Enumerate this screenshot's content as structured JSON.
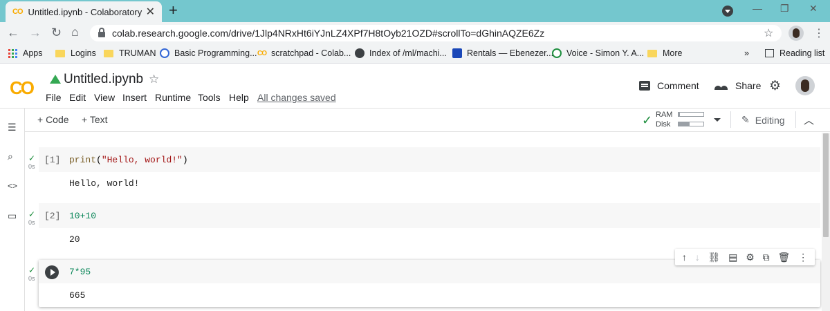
{
  "browser": {
    "tab_title": "Untitled.ipynb - Colaboratory",
    "tab_logo": "CO",
    "url": "colab.research.google.com/drive/1Jlp4NRxHt6iYJnLZ4XPf7H8tOyb21OZD#scrollTo=dGhinAQZE6Zz",
    "bookmarks": [
      "Apps",
      "Logins",
      "TRUMAN",
      "Basic Programming...",
      "scratchpad - Colab...",
      "Index of /ml/machi...",
      "Rentals — Ebenezer...",
      "Voice - Simon Y. A...",
      "More"
    ],
    "overflow": "»",
    "reading_list": "Reading list"
  },
  "colab": {
    "logo": "CO",
    "notebook_title": "Untitled.ipynb",
    "menu": [
      "File",
      "Edit",
      "View",
      "Insert",
      "Runtime",
      "Tools",
      "Help"
    ],
    "save_status": "All changes saved",
    "comment": "Comment",
    "share": "Share",
    "add_code": "+ Code",
    "add_text": "+ Text",
    "ram_label": "RAM",
    "disk_label": "Disk",
    "ram_usage": 0.05,
    "disk_usage": 0.45,
    "mode": "Editing"
  },
  "cells": [
    {
      "count": "[1]",
      "code": "print(\"Hello, world!\")",
      "output": "Hello, world!",
      "time": "0s"
    },
    {
      "count": "[2]",
      "code": "10+10",
      "output": "20",
      "time": "0s"
    },
    {
      "count": "",
      "code": "7*95",
      "output": "665",
      "time": "0s"
    }
  ],
  "colors": {
    "accent_orange": "#f9ab00",
    "tab_bar": "#74c7ce",
    "ok_green": "#1e8e3e"
  }
}
